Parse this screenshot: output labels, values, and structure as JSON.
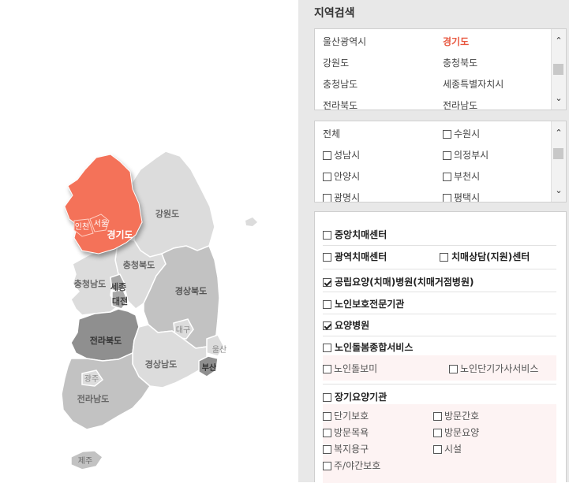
{
  "map": {
    "regions": [
      {
        "key": "gangwon",
        "label": "강원도"
      },
      {
        "key": "incheon",
        "label": "인천"
      },
      {
        "key": "seoul",
        "label": "서울"
      },
      {
        "key": "gyeonggi",
        "label": "경기도"
      },
      {
        "key": "chungbuk",
        "label": "충청북도"
      },
      {
        "key": "chungnam",
        "label": "충청남도"
      },
      {
        "key": "sejong",
        "label": "세종"
      },
      {
        "key": "daejeon",
        "label": "대전"
      },
      {
        "key": "gyeongbuk",
        "label": "경상북도"
      },
      {
        "key": "daegu",
        "label": "대구"
      },
      {
        "key": "ulsan",
        "label": "울산"
      },
      {
        "key": "jeonbuk",
        "label": "전라북도"
      },
      {
        "key": "gyeongnam",
        "label": "경상남도"
      },
      {
        "key": "busan",
        "label": "부산"
      },
      {
        "key": "gwangju",
        "label": "광주"
      },
      {
        "key": "jeonnam",
        "label": "전라남도"
      },
      {
        "key": "jeju",
        "label": "제주"
      }
    ],
    "selected": "경기도",
    "colors": {
      "selected": "#f47259",
      "light": "#dcdcdc",
      "mid": "#c2c2c2",
      "dark": "#a8a8a8",
      "darker": "#8f8f8f"
    }
  },
  "search": {
    "title": "지역검색",
    "provinces": [
      [
        "울산광역시",
        "경기도"
      ],
      [
        "강원도",
        "충청북도"
      ],
      [
        "충청남도",
        "세종특별자치시"
      ],
      [
        "전라북도",
        "전라남도"
      ]
    ],
    "selected_province": "경기도",
    "cities": [
      [
        "전체",
        "수원시"
      ],
      [
        "성남시",
        "의정부시"
      ],
      [
        "안양시",
        "부천시"
      ],
      [
        "광명시",
        "평택시"
      ]
    ]
  },
  "facilities": {
    "central": "중앙치매센터",
    "regional": "광역치매센터",
    "counseling": "치매상담(지원)센터",
    "public_hospital": "공립요양(치매)병원(치매거점병원)",
    "elder_protection": "노인보호전문기관",
    "nursing_hospital": "요양병원",
    "care_service": "노인돌봄종합서비스",
    "care_sub": [
      "노인돌보미",
      "노인단기가사서비스"
    ],
    "longterm": "장기요양기관",
    "longterm_sub": [
      "단기보호",
      "방문간호",
      "방문목욕",
      "방문요양",
      "복지용구",
      "시설",
      "주/야간보호"
    ]
  }
}
